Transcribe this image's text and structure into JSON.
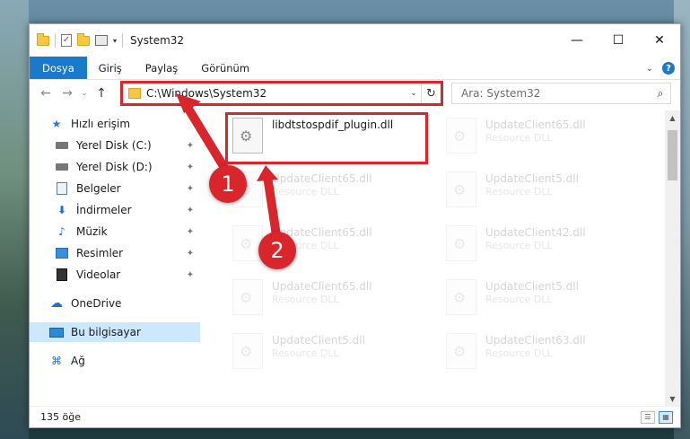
{
  "window": {
    "title": "System32",
    "controls": {
      "minimize": "—",
      "maximize": "☐",
      "close": "✕"
    }
  },
  "ribbon": {
    "tabs": [
      "Dosya",
      "Giriş",
      "Paylaş",
      "Görünüm"
    ],
    "collapse": "⌄",
    "help": "?"
  },
  "nav": {
    "back": "←",
    "forward": "→",
    "recent": "⌄",
    "up": "↑",
    "address": "C:\\Windows\\System32",
    "address_dropdown": "⌄",
    "refresh": "↻",
    "search_placeholder": "Ara: System32",
    "search_icon": "⌕"
  },
  "sidebar": {
    "items": [
      {
        "label": "Hızlı erişim",
        "icon": "star-icon"
      },
      {
        "label": "Yerel Disk (C:)",
        "icon": "drive-icon",
        "pinned": true
      },
      {
        "label": "Yerel Disk (D:)",
        "icon": "drive-icon",
        "pinned": true
      },
      {
        "label": "Belgeler",
        "icon": "documents-icon",
        "pinned": true
      },
      {
        "label": "İndirmeler",
        "icon": "download-icon",
        "pinned": true
      },
      {
        "label": "Müzik",
        "icon": "music-icon",
        "pinned": true
      },
      {
        "label": "Resimler",
        "icon": "pictures-icon",
        "pinned": true
      },
      {
        "label": "Videolar",
        "icon": "videos-icon",
        "pinned": true
      },
      {
        "label": "OneDrive",
        "icon": "cloud-icon"
      },
      {
        "label": "Bu bilgisayar",
        "icon": "computer-icon",
        "selected": true
      },
      {
        "label": "Ağ",
        "icon": "network-icon"
      }
    ],
    "pin_glyph": "📌"
  },
  "files": {
    "highlighted": {
      "name": "libdtstospdif_plugin.dll",
      "type": ""
    },
    "faded": [
      {
        "name": "UpdateClient65.dll",
        "type": "Resource DLL"
      },
      {
        "name": "UpdateClient65.dll",
        "type": "Resource DLL"
      },
      {
        "name": "UpdateClient5.dll",
        "type": "Resource DLL"
      },
      {
        "name": "UpdateClient65.dll",
        "type": "Resource DLL"
      },
      {
        "name": "UpdateClient42.dll",
        "type": "Resource DLL"
      },
      {
        "name": "UpdateClient65.dll",
        "type": "Resource DLL"
      },
      {
        "name": "UpdateClient5.dll",
        "type": "Resource DLL"
      },
      {
        "name": "UpdateClient5.dll",
        "type": "Resource DLL"
      },
      {
        "name": "UpdateClient63.dll",
        "type": "Resource DLL"
      }
    ]
  },
  "status": {
    "count": "135 öğe"
  },
  "annotations": {
    "step1": "1",
    "step2": "2"
  },
  "colors": {
    "accent": "#1979ca",
    "highlight": "#d9262c",
    "selected": "#cce8ff"
  }
}
